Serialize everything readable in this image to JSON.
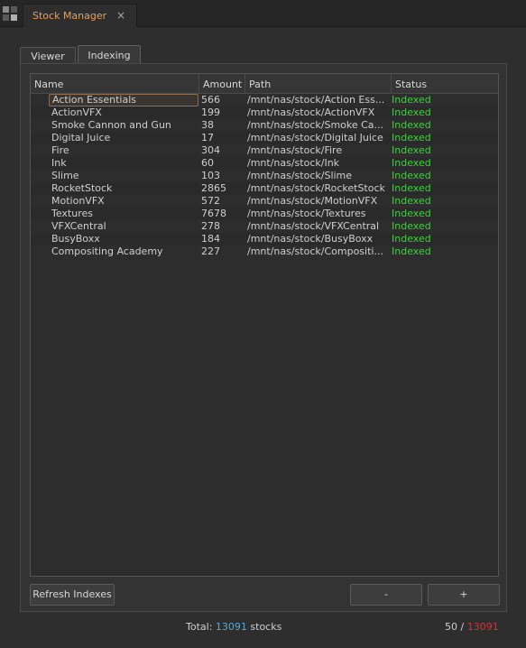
{
  "panel": {
    "tab_title": "Stock Manager",
    "close_glyph": "×"
  },
  "tabs": [
    {
      "label": "Viewer"
    },
    {
      "label": "Indexing"
    }
  ],
  "active_tab": "Indexing",
  "table": {
    "columns": [
      "Name",
      "Amount",
      "Path",
      "Status"
    ],
    "rows": [
      {
        "name": "Action Essentials",
        "amount": "566",
        "path": "/mnt/nas/stock/Action Ess...",
        "status": "Indexed"
      },
      {
        "name": "ActionVFX",
        "amount": "199",
        "path": "/mnt/nas/stock/ActionVFX",
        "status": "Indexed"
      },
      {
        "name": "Smoke Cannon and Gun",
        "amount": "38",
        "path": "/mnt/nas/stock/Smoke Ca...",
        "status": "Indexed"
      },
      {
        "name": "Digital Juice",
        "amount": "17",
        "path": "/mnt/nas/stock/Digital Juice",
        "status": "Indexed"
      },
      {
        "name": "Fire",
        "amount": "304",
        "path": "/mnt/nas/stock/Fire",
        "status": "Indexed"
      },
      {
        "name": "Ink",
        "amount": "60",
        "path": "/mnt/nas/stock/Ink",
        "status": "Indexed"
      },
      {
        "name": "Slime",
        "amount": "103",
        "path": "/mnt/nas/stock/Slime",
        "status": "Indexed"
      },
      {
        "name": "RocketStock",
        "amount": "2865",
        "path": "/mnt/nas/stock/RocketStock",
        "status": "Indexed"
      },
      {
        "name": "MotionVFX",
        "amount": "572",
        "path": "/mnt/nas/stock/MotionVFX",
        "status": "Indexed"
      },
      {
        "name": "Textures",
        "amount": "7678",
        "path": "/mnt/nas/stock/Textures",
        "status": "Indexed"
      },
      {
        "name": "VFXCentral",
        "amount": "278",
        "path": "/mnt/nas/stock/VFXCentral",
        "status": "Indexed"
      },
      {
        "name": "BusyBoxx",
        "amount": "184",
        "path": "/mnt/nas/stock/BusyBoxx",
        "status": "Indexed"
      },
      {
        "name": "Compositing Academy",
        "amount": "227",
        "path": "/mnt/nas/stock/Compositi...",
        "status": "Indexed"
      }
    ],
    "selected_row": 0
  },
  "buttons": {
    "refresh": "Refresh Indexes",
    "minus": "-",
    "plus": "+"
  },
  "footer": {
    "total_prefix": "Total: ",
    "total_value": "13091",
    "total_suffix": " stocks",
    "page_shown": "50",
    "page_sep": " / ",
    "page_total": "13091"
  },
  "colors": {
    "accent_orange": "#e0a060",
    "status_indexed": "#3cd33c",
    "total_blue": "#58a8d8",
    "total_red": "#d83030"
  }
}
